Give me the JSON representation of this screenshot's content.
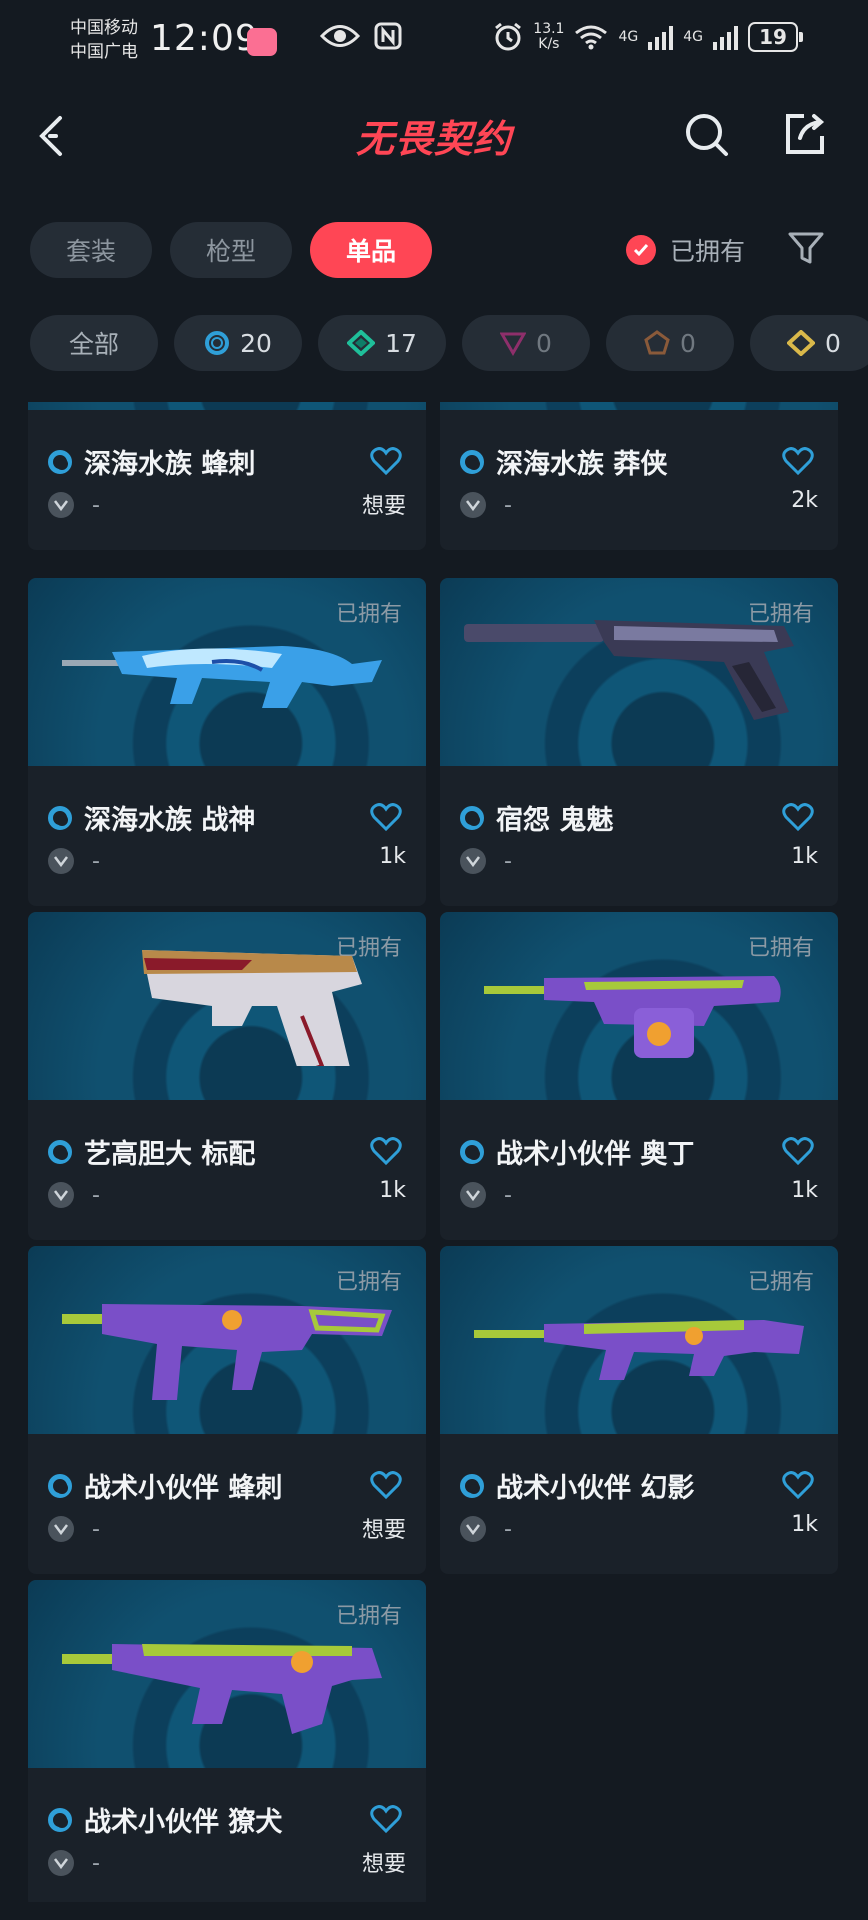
{
  "status_bar": {
    "carrier1": "中国移动",
    "carrier2": "中国广电",
    "time": "12:09",
    "speed_value": "13.1",
    "speed_unit": "K/s",
    "net1": "4G",
    "net2": "4G",
    "battery": "19"
  },
  "header": {
    "title": "无畏契约"
  },
  "tabs": [
    {
      "label": "套装",
      "active": false
    },
    {
      "label": "枪型",
      "active": false
    },
    {
      "label": "单品",
      "active": true
    }
  ],
  "owned_filter_label": "已拥有",
  "tiers": {
    "all_label": "全部",
    "blue": "20",
    "green": "17",
    "purple": "0",
    "orange": "0",
    "gold": "0"
  },
  "colors": {
    "accent": "#ff4655",
    "background": "#141a21",
    "card": "#1a2129",
    "tier_blue": "#2f9fd8",
    "tier_green": "#1fbf9a"
  },
  "items": [
    {
      "name": "深海水族 蜂刺",
      "owned": "",
      "count": "想要",
      "rarity": "-",
      "weapon": "none"
    },
    {
      "name": "深海水族 莽侠",
      "owned": "",
      "count": "2k",
      "rarity": "-",
      "weapon": "none"
    },
    {
      "name": "深海水族 战神",
      "owned": "已拥有",
      "count": "1k",
      "rarity": "-",
      "weapon": "rifle-blue"
    },
    {
      "name": "宿怨 鬼魅",
      "owned": "已拥有",
      "count": "1k",
      "rarity": "-",
      "weapon": "pistol-dark"
    },
    {
      "name": "艺高胆大 标配",
      "owned": "已拥有",
      "count": "1k",
      "rarity": "-",
      "weapon": "pistol-white"
    },
    {
      "name": "战术小伙伴 奥丁",
      "owned": "已拥有",
      "count": "1k",
      "rarity": "-",
      "weapon": "lmg-purple"
    },
    {
      "name": "战术小伙伴 蜂刺",
      "owned": "已拥有",
      "count": "想要",
      "rarity": "-",
      "weapon": "smg-purple"
    },
    {
      "name": "战术小伙伴 幻影",
      "owned": "已拥有",
      "count": "1k",
      "rarity": "-",
      "weapon": "rifle-purple"
    },
    {
      "name": "战术小伙伴 獠犬",
      "owned": "已拥有",
      "count": "想要",
      "rarity": "-",
      "weapon": "bullpup-purple"
    }
  ]
}
